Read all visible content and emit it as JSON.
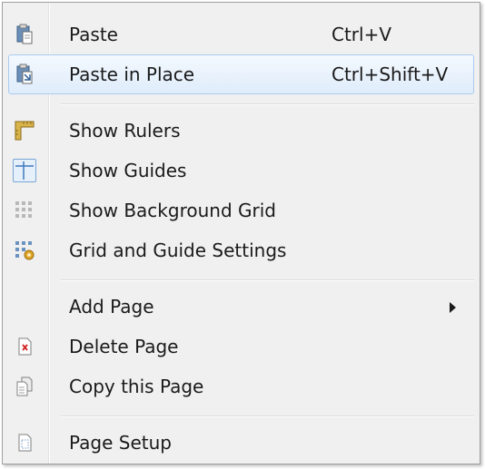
{
  "menu": {
    "items": [
      {
        "label": "Paste",
        "shortcut": "Ctrl+V",
        "icon": "paste-icon"
      },
      {
        "label": "Paste in Place",
        "shortcut": "Ctrl+Shift+V",
        "icon": "paste-in-place-icon",
        "highlighted": true
      },
      {
        "label": "Show Rulers",
        "icon": "rulers-icon"
      },
      {
        "label": "Show Guides",
        "icon": "guides-icon",
        "checked": true
      },
      {
        "label": "Show Background Grid",
        "icon": "grid-icon"
      },
      {
        "label": "Grid and Guide Settings",
        "icon": "grid-settings-icon"
      },
      {
        "label": "Add Page",
        "icon": "submenu-arrow-icon",
        "has_submenu": true
      },
      {
        "label": "Delete Page",
        "icon": "delete-page-icon"
      },
      {
        "label": "Copy this Page",
        "icon": "copy-page-icon"
      },
      {
        "label": "Page Setup",
        "icon": "page-setup-icon"
      }
    ]
  },
  "colors": {
    "highlight_border": "#aaccf0",
    "highlight_fill": "#dfecfb",
    "menu_bg": "#f0f0f0"
  }
}
